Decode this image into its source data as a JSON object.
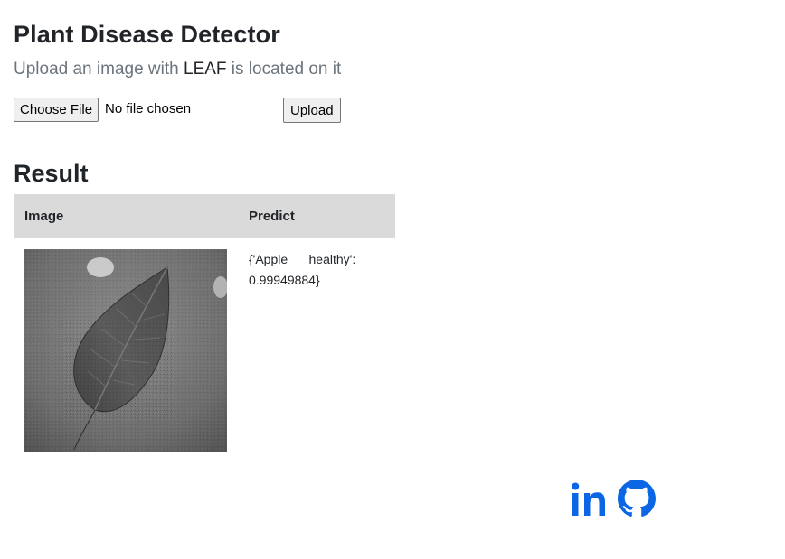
{
  "header": {
    "title": "Plant Disease Detector",
    "subtitle_pre": "Upload an image with ",
    "subtitle_em": "LEAF",
    "subtitle_post": " is located on it"
  },
  "upload": {
    "choose_label": "Choose File",
    "file_status": "No file chosen",
    "upload_label": "Upload"
  },
  "result": {
    "heading": "Result",
    "columns": [
      "Image",
      "Predict"
    ],
    "rows": [
      {
        "prediction": "{'Apple___healthy': 0.99949884}"
      }
    ]
  },
  "social": {
    "icons": [
      "linkedin-icon",
      "github-icon"
    ],
    "color": "#0a66e4"
  }
}
